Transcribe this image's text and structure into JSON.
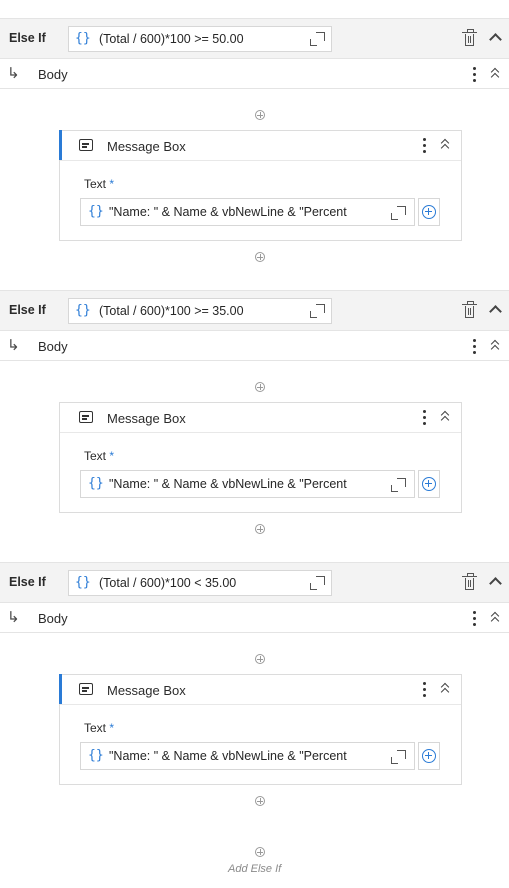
{
  "sections": [
    {
      "else_if_label": "Else If",
      "condition": "(Total / 600)*100 >= 50.00",
      "body_label": "Body",
      "activity": {
        "title": "Message Box",
        "text_label": "Text",
        "required_mark": "*",
        "text_value": "\"Name: \" & Name & vbNewLine & \"Percent"
      }
    },
    {
      "else_if_label": "Else If",
      "condition": "(Total / 600)*100 >= 35.00",
      "body_label": "Body",
      "activity": {
        "title": "Message Box",
        "text_label": "Text",
        "required_mark": "*",
        "text_value": "\"Name: \" & Name & vbNewLine & \"Percent"
      }
    },
    {
      "else_if_label": "Else If",
      "condition": "(Total / 600)*100 < 35.00",
      "body_label": "Body",
      "activity": {
        "title": "Message Box",
        "text_label": "Text",
        "required_mark": "*",
        "text_value": "\"Name: \" & Name & vbNewLine & \"Percent"
      }
    }
  ],
  "symbols": {
    "brace": "{}",
    "body_arrow": "↳"
  },
  "footer": {
    "add_else_if_label": "Add Else If"
  },
  "colors": {
    "accent": "#2a7bd6",
    "header_bg": "#f3f3f3"
  }
}
